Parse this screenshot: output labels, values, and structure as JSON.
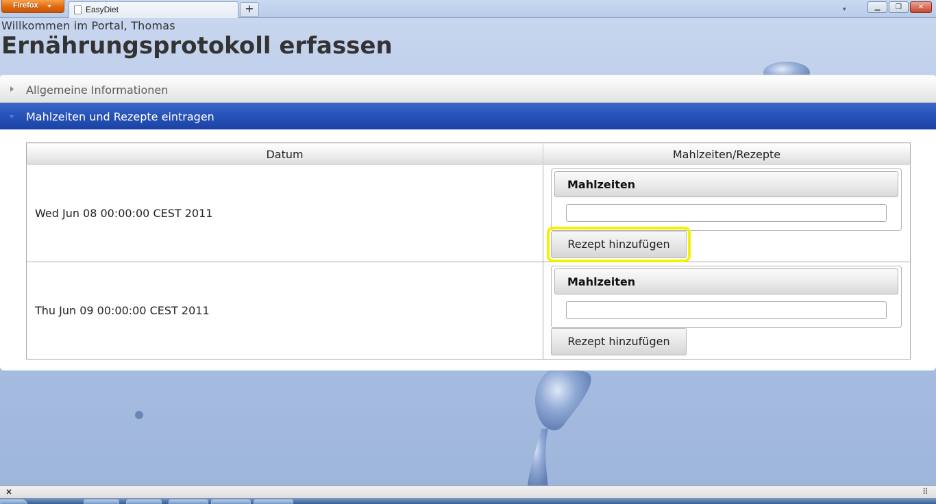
{
  "browser": {
    "app_button_label": "Firefox",
    "tab_title": "EasyDiet",
    "new_tab_label": "+",
    "minimize_label": "▁",
    "maximize_label": "❐",
    "close_label": "✕"
  },
  "header": {
    "welcome": "Willkommen im Portal, Thomas",
    "title": "Ernährungsprotokoll erfassen"
  },
  "accordion": {
    "sections": [
      {
        "label": "Allgemeine Informationen",
        "expanded": false
      },
      {
        "label": "Mahlzeiten und Rezepte eintragen",
        "expanded": true
      }
    ]
  },
  "table": {
    "columns": [
      "Datum",
      "Mahlzeiten/Rezepte"
    ],
    "rows": [
      {
        "date": "Wed Jun 08 00:00:00 CEST 2011",
        "meals_legend": "Mahlzeiten",
        "meals_value": "",
        "add_button": "Rezept hinzufügen",
        "highlighted": true
      },
      {
        "date": "Thu Jun 09 00:00:00 CEST 2011",
        "meals_legend": "Mahlzeiten",
        "meals_value": "",
        "add_button": "Rezept hinzufügen",
        "highlighted": false
      }
    ]
  },
  "statusbar": {
    "close_label": "×"
  },
  "colors": {
    "accent": "#2652b8",
    "highlight": "#f2f200",
    "background": "#b7c8e6"
  }
}
